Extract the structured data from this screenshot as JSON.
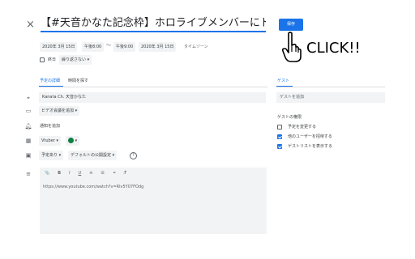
{
  "header": {
    "close_glyph": "×",
    "title": "【#天音かなた記念枠】ホロライブメンバーにドッキリ",
    "save_label": "保存"
  },
  "datetime": {
    "start_date": "2020年 3月 15日",
    "start_time": "午後8:00",
    "separator": "〜",
    "end_time": "午後9:00",
    "end_date": "2020年 3月 15日",
    "timezone": "タイムゾーン"
  },
  "allday": {
    "label": "終日",
    "checked": false,
    "repeat": "繰り返さない"
  },
  "tabs": [
    {
      "label": "予定の詳細",
      "active": true
    },
    {
      "label": "時間を探す",
      "active": false
    }
  ],
  "details": {
    "location": "Kanata Ch. 天音かなた",
    "conference_button": "ビデオ会議を追加",
    "notification": "通知を追加",
    "calendar": "Vtuber",
    "calendar_color": "#0b8043",
    "availability": "予定あり",
    "visibility": "デフォルトの公開設定",
    "help_glyph": "?"
  },
  "description": {
    "toolbar": [
      "📎",
      "B",
      "I",
      "U",
      "≡",
      "☰",
      "⚭",
      "T̸"
    ],
    "text": "https://www.youtube.com/watch?v=Rlv5Y07FOdg"
  },
  "guests": {
    "tab_label": "ゲスト",
    "add_placeholder": "ゲストを追加",
    "permissions_title": "ゲストの権限",
    "permissions": [
      {
        "label": "予定を変更する",
        "checked": false
      },
      {
        "label": "他のユーザーを招待する",
        "checked": true
      },
      {
        "label": "ゲストリストを表示する",
        "checked": true
      }
    ]
  },
  "overlay": {
    "click_text": "CLICK!!"
  }
}
